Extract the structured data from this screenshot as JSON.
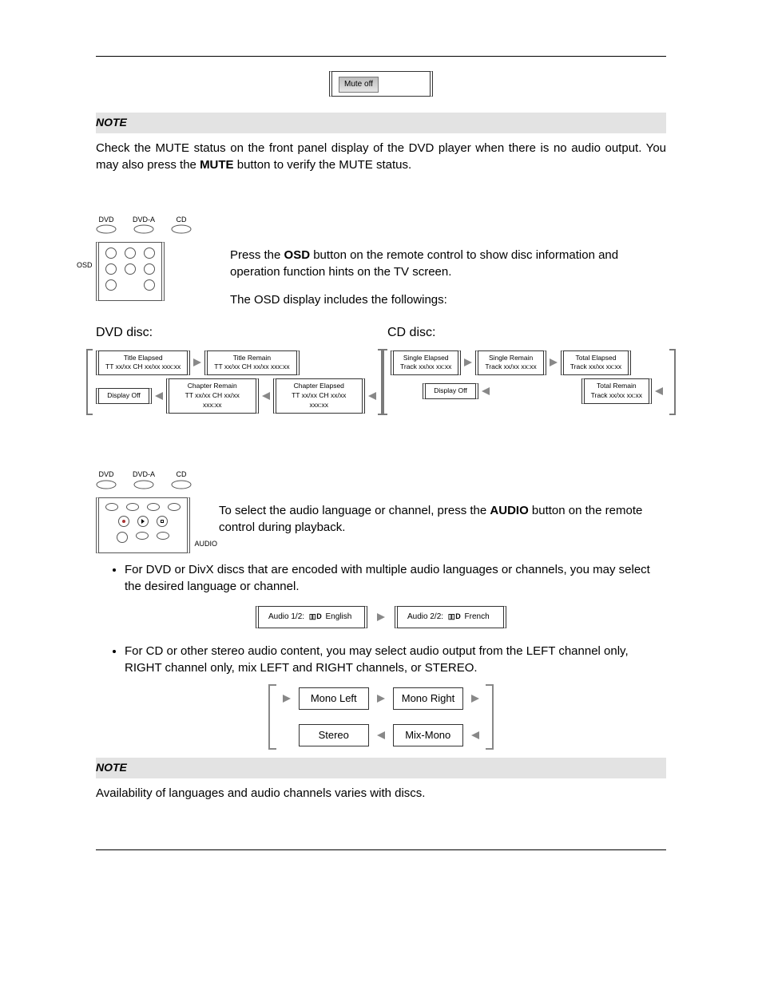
{
  "mute_box": "Mute off",
  "note_label": "NOTE",
  "note1": {
    "part1": "Check the MUTE status on the front panel display of the DVD player when there is no audio output.  You may also press the ",
    "btn": "MUTE",
    "part2": " button to verify the MUTE status."
  },
  "disc_labels": [
    "DVD",
    "DVD-A",
    "CD"
  ],
  "osd_section": {
    "label": "OSD",
    "p1a": "Press the ",
    "p1btn": "OSD",
    "p1b": " button on the remote control to show disc information and operation function hints on the TV screen.",
    "p2": "The OSD display includes the followings:"
  },
  "headers": {
    "dvd": "DVD disc:",
    "cd": "CD disc:"
  },
  "dvd_flow": {
    "r1": [
      {
        "t1": "Title Elapsed",
        "t2": "TT xx/xx CH xx/xx  xxx:xx"
      },
      {
        "t1": "Title Remain",
        "t2": "TT xx/xx CH xx/xx  xxx:xx"
      }
    ],
    "r2": [
      {
        "t1": "Display Off",
        "t2": ""
      },
      {
        "t1": "Chapter Remain",
        "t2": "TT xx/xx CH xx/xx  xxx:xx"
      },
      {
        "t1": "Chapter Elapsed",
        "t2": "TT xx/xx CH xx/xx  xxx:xx"
      }
    ]
  },
  "cd_flow": {
    "r1": [
      {
        "t1": "Single Elapsed",
        "t2": "Track xx/xx  xx:xx"
      },
      {
        "t1": "Single Remain",
        "t2": "Track xx/xx  xx:xx"
      },
      {
        "t1": "Total Elapsed",
        "t2": "Track xx/xx  xx:xx"
      }
    ],
    "r2": [
      {
        "t1": "Display Off",
        "t2": ""
      },
      {
        "t1": "Total Remain",
        "t2": "Track xx/xx  xx:xx"
      }
    ]
  },
  "audio_section": {
    "label": "AUDIO",
    "p1a": "To select the audio language or channel, press the ",
    "p1btn": "AUDIO",
    "p1b": " button on the remote control during playback.",
    "bullet1": "For DVD or DivX discs that are encoded with multiple audio languages or channels, you may select the desired language or channel.",
    "bullet2": "For CD or other stereo audio content, you may select audio output from the LEFT channel only, RIGHT channel only, mix LEFT and RIGHT channels, or STEREO."
  },
  "lang_demo": {
    "a_pre": "Audio  1/2:",
    "a_post": "English",
    "b_pre": "Audio  2/2:",
    "b_post": "French",
    "dolby": "▯▯ D"
  },
  "mono": {
    "ml": "Mono Left",
    "mr": "Mono Right",
    "st": "Stereo",
    "mm": "Mix-Mono"
  },
  "note2": "Availability of languages and audio channels varies with discs."
}
